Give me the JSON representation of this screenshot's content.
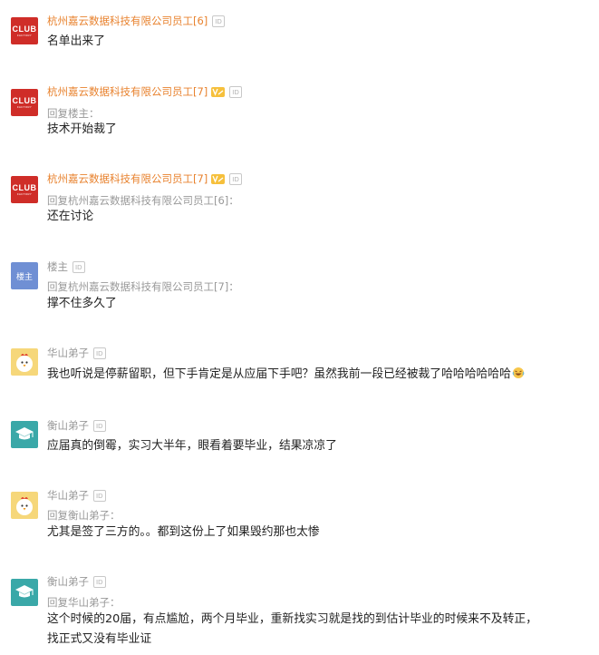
{
  "comments": [
    {
      "name": "杭州嘉云数据科技有限公司员工[6]",
      "reply_to": "",
      "text": "名单出来了",
      "avatar": "club-factory-logo"
    },
    {
      "name": "杭州嘉云数据科技有限公司员工[7]",
      "reply_to": "回复楼主：",
      "text": "技术开始裁了",
      "avatar": "club-factory-logo"
    },
    {
      "name": "杭州嘉云数据科技有限公司员工[7]",
      "reply_to": "回复杭州嘉云数据科技有限公司员工[6]：",
      "text": "还在讨论",
      "avatar": "club-factory-logo"
    },
    {
      "name": "楼主",
      "reply_to": "回复杭州嘉云数据科技有限公司员工[7]：",
      "text": "撑不住多久了",
      "avatar_text": "楼主"
    },
    {
      "name": "华山弟子",
      "reply_to": "",
      "text": "我也听说是停薪留职，但下手肯定是从应届下手吧？虽然我前一段已经被裁了哈哈哈哈哈哈",
      "avatar": "chick-avatar"
    },
    {
      "name": "衡山弟子",
      "reply_to": "",
      "text": "应届真的倒霉，实习大半年，眼看着要毕业，结果凉凉了",
      "avatar": "graduation-cap-avatar"
    },
    {
      "name": "华山弟子",
      "reply_to": "回复衡山弟子：",
      "text": "尤其是签了三方的。。都到这份上了如果毁约那也太惨",
      "avatar": "chick-avatar"
    },
    {
      "name": "衡山弟子",
      "reply_to": "回复华山弟子：",
      "text_line1": "这个时候的20届，有点尴尬，两个月毕业，重新找实习就是找的到估计毕业的时候来不及转正，",
      "text_line2": "找正式又没有毕业证",
      "avatar": "graduation-cap-avatar"
    }
  ],
  "id_badge": "ID",
  "club_logo": {
    "top": "CLUB",
    "bottom": "FACTORY"
  },
  "colors": {
    "company_name": "#e8822e",
    "username": "#999999",
    "club_red": "#cf2d28",
    "louzhu_blue": "#6f8fd4",
    "teal": "#3aa8a8",
    "chick_yellow": "#f6d77a",
    "v_badge": "#f6c03c"
  }
}
